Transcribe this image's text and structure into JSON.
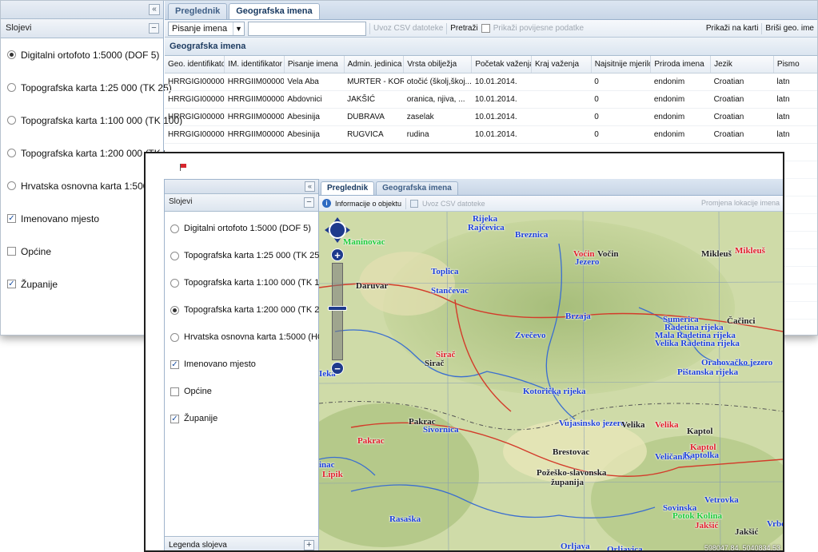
{
  "back": {
    "left_panel": {
      "collapse_glyph": "«",
      "title": "Slojevi",
      "min_glyph": "−",
      "layers": [
        {
          "label": "Digitalni ortofoto 1:5000 (DOF 5)",
          "type": "radio",
          "checked": true
        },
        {
          "label": "Topografska karta 1:25 000 (TK 25)",
          "type": "radio",
          "checked": false
        },
        {
          "label": "Topografska karta 1:100 000 (TK 100)",
          "type": "radio",
          "checked": false
        },
        {
          "label": "Topografska karta 1:200 000 (TK 200)",
          "type": "radio",
          "checked": false
        },
        {
          "label": "Hrvatska osnovna karta 1:5000 (HOK 5)",
          "type": "radio",
          "checked": false
        },
        {
          "label": "Imenovano mjesto",
          "type": "checkbox",
          "checked": true
        },
        {
          "label": "Općine",
          "type": "checkbox",
          "checked": false
        },
        {
          "label": "Županije",
          "type": "checkbox",
          "checked": true
        }
      ]
    },
    "tabs": [
      "Preglednik",
      "Geografska imena"
    ],
    "toolbar": {
      "select_value": "Pisanje imena",
      "csv_label": "Uvoz CSV datoteke",
      "search_label": "Pretraži",
      "history_label": "Prikaži povijesne podatke",
      "show_on_map": "Prikaži na karti",
      "delete_label": "Briši geo. ime"
    },
    "grid": {
      "title": "Geografska imena",
      "columns": [
        "Geo. identifikator",
        "IM. identifikator",
        "Pisanje imena",
        "Admin. jedinica",
        "Vrsta obilježja",
        "Početak važenja",
        "Kraj važenja",
        "Najsitnije mjerilo pri",
        "Priroda imena",
        "Jezik",
        "Pismo"
      ],
      "rows": [
        [
          "HRRGIGI000000...",
          "HRRGIIM00000...",
          "Vela Aba",
          "MURTER - KORN...",
          "otočić (školj,škoj...",
          "10.01.2014.",
          "",
          "0",
          "endonim",
          "Croatian",
          "latn"
        ],
        [
          "HRRGIGI000000...",
          "HRRGIIM00000...",
          "Abdovnici",
          "JAKŠIĆ",
          "oranica, njiva, ...",
          "10.01.2014.",
          "",
          "0",
          "endonim",
          "Croatian",
          "latn"
        ],
        [
          "HRRGIGI000000...",
          "HRRGIIM00000...",
          "Abesinija",
          "DUBRAVA",
          "zaselak",
          "10.01.2014.",
          "",
          "0",
          "endonim",
          "Croatian",
          "latn"
        ],
        [
          "HRRGIGI000000...",
          "HRRGIIM00000...",
          "Abesinija",
          "RUGVICA",
          "rudina",
          "10.01.2014.",
          "",
          "0",
          "endonim",
          "Croatian",
          "latn"
        ]
      ]
    }
  },
  "front": {
    "left_panel": {
      "collapse_glyph": "«",
      "title": "Slojevi",
      "min_glyph": "−",
      "layers": [
        {
          "label": "Digitalni ortofoto 1:5000 (DOF 5)",
          "type": "radio",
          "checked": false
        },
        {
          "label": "Topografska karta 1:25 000 (TK 25)",
          "type": "radio",
          "checked": false
        },
        {
          "label": "Topografska karta 1:100 000 (TK 100)",
          "type": "radio",
          "checked": false
        },
        {
          "label": "Topografska karta 1:200 000 (TK 200)",
          "type": "radio",
          "checked": true
        },
        {
          "label": "Hrvatska osnovna karta 1:5000 (HOK 5)",
          "type": "radio",
          "checked": false
        },
        {
          "label": "Imenovano mjesto",
          "type": "checkbox",
          "checked": true
        },
        {
          "label": "Općine",
          "type": "checkbox",
          "checked": false
        },
        {
          "label": "Županije",
          "type": "checkbox",
          "checked": true
        }
      ],
      "legend_label": "Legenda slojeva",
      "legend_glyph": "+"
    },
    "tabs": [
      "Preglednik",
      "Geografska imena"
    ],
    "toolbar": {
      "info_label": "Informacije o objektu",
      "csv_label": "Uvoz CSV datoteke",
      "relocate_label": "Promjena lokacije imena"
    },
    "map": {
      "zoom_in": "+",
      "zoom_out": "−",
      "coordinates": "598047.84, 5040834.53",
      "place_labels": [
        {
          "text": "Rijeka",
          "color": "blue"
        },
        {
          "text": "Rajčevica",
          "color": "blue"
        },
        {
          "text": "Maninovac",
          "color": "green"
        },
        {
          "text": "Breznica",
          "color": "blue"
        },
        {
          "text": "Voćin",
          "color": "red"
        },
        {
          "text": "Jezero",
          "color": "blue"
        },
        {
          "text": "Vočin",
          "color": "black"
        },
        {
          "text": "Mikleuš",
          "color": "black"
        },
        {
          "text": "Mikleuš",
          "color": "red"
        },
        {
          "text": "Toplica",
          "color": "blue"
        },
        {
          "text": "Daruvar",
          "color": "black"
        },
        {
          "text": "Stančevac",
          "color": "blue"
        },
        {
          "text": "Čačinci",
          "color": "black"
        },
        {
          "text": "Brzaja",
          "color": "blue"
        },
        {
          "text": "Sumerica",
          "color": "blue"
        },
        {
          "text": "Radetina rijeka",
          "color": "blue"
        },
        {
          "text": "Zvečevo",
          "color": "blue"
        },
        {
          "text": "Mala Radetina rijeka",
          "color": "blue"
        },
        {
          "text": "Velika Radetina rijeka",
          "color": "blue"
        },
        {
          "text": "Sirač",
          "color": "black"
        },
        {
          "text": "Sirač",
          "color": "red"
        },
        {
          "text": "Pištanska rijeka",
          "color": "blue"
        },
        {
          "text": "Orahovačko jezero",
          "color": "blue"
        },
        {
          "text": "Kotorička rijeka",
          "color": "blue"
        },
        {
          "text": "Pakrac",
          "color": "black"
        },
        {
          "text": "Sivornica",
          "color": "blue"
        },
        {
          "text": "Vujasinsko jezero",
          "color": "blue"
        },
        {
          "text": "Velika",
          "color": "black"
        },
        {
          "text": "Velika",
          "color": "red"
        },
        {
          "text": "Kaptol",
          "color": "black"
        },
        {
          "text": "Pakrac",
          "color": "red"
        },
        {
          "text": "Kaptol",
          "color": "red"
        },
        {
          "text": "Veličanka",
          "color": "blue"
        },
        {
          "text": "Kaptolka",
          "color": "blue"
        },
        {
          "text": "Brestovac",
          "color": "black"
        },
        {
          "text": "Lipik",
          "color": "red"
        },
        {
          "text": "Požeško-slavonska",
          "color": "black"
        },
        {
          "text": "županija",
          "color": "black"
        },
        {
          "text": "Orljava",
          "color": "blue"
        },
        {
          "text": "Rasaška",
          "color": "blue"
        },
        {
          "text": "Sovinska",
          "color": "blue"
        },
        {
          "text": "Vetrovka",
          "color": "blue"
        },
        {
          "text": "Jakšić",
          "color": "red"
        },
        {
          "text": "Jakšić",
          "color": "black"
        },
        {
          "text": "Vrbova",
          "color": "blue"
        },
        {
          "text": "Orljavica",
          "color": "blue"
        },
        {
          "text": "Ieka",
          "color": "blue"
        },
        {
          "text": "inac",
          "color": "blue"
        },
        {
          "text": "Potok Kolina",
          "color": "green"
        }
      ]
    }
  }
}
